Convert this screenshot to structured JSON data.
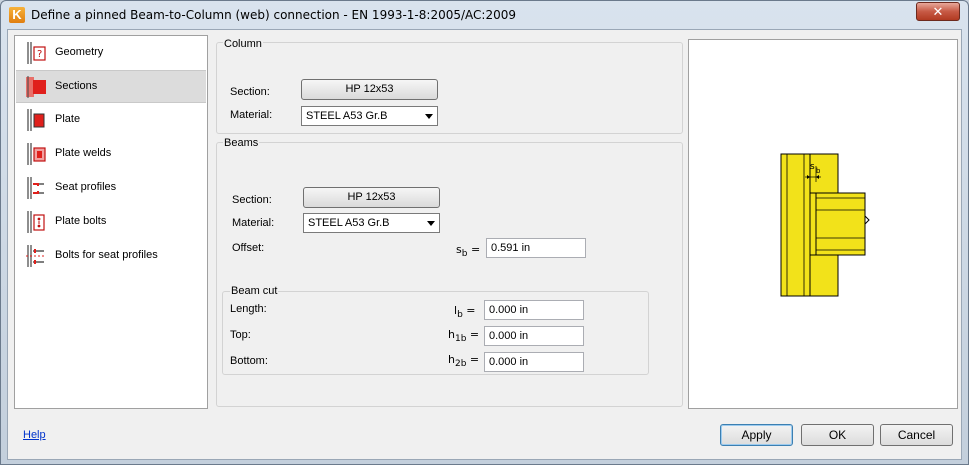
{
  "window": {
    "title": "Define a pinned Beam-to-Column (web) connection - EN 1993-1-8:2005/AC:2009",
    "close_label": "✕",
    "app_icon_letter": "K"
  },
  "nav": {
    "items": [
      {
        "label": "Geometry",
        "icon": "geometry-icon"
      },
      {
        "label": "Sections",
        "icon": "sections-icon"
      },
      {
        "label": "Plate",
        "icon": "plate-icon"
      },
      {
        "label": "Plate welds",
        "icon": "plate-welds-icon"
      },
      {
        "label": "Seat profiles",
        "icon": "seat-profiles-icon"
      },
      {
        "label": "Plate bolts",
        "icon": "plate-bolts-icon"
      },
      {
        "label": "Bolts for seat profiles",
        "icon": "bolts-seat-icon"
      }
    ],
    "selected_index": 1
  },
  "column": {
    "title": "Column",
    "section_label": "Section:",
    "section_value": "HP 12x53",
    "material_label": "Material:",
    "material_value": "STEEL A53 Gr.B"
  },
  "beams": {
    "title": "Beams",
    "section_label": "Section:",
    "section_value": "HP 12x53",
    "material_label": "Material:",
    "material_value": "STEEL A53 Gr.B",
    "offset_label": "Offset:",
    "offset_symbol": "s",
    "offset_sub": "b",
    "offset_value": "0.591 in"
  },
  "beam_cut": {
    "title": "Beam cut",
    "length_label": "Length:",
    "length_symbol": "l",
    "length_sub": "b",
    "length_value": "0.000 in",
    "top_label": "Top:",
    "top_symbol": "h",
    "top_sub": "1b",
    "top_value": "0.000 in",
    "bottom_label": "Bottom:",
    "bottom_symbol": "h",
    "bottom_sub": "2b",
    "bottom_value": "0.000 in"
  },
  "preview": {
    "dimension_symbol": "s",
    "dimension_sub": "b"
  },
  "footer": {
    "help_label": "Help",
    "apply_label": "Apply",
    "ok_label": "OK",
    "cancel_label": "Cancel"
  },
  "colors": {
    "steel_fill": "#f2e21a",
    "steel_stroke": "#000000",
    "accent_red": "#e0201c"
  }
}
